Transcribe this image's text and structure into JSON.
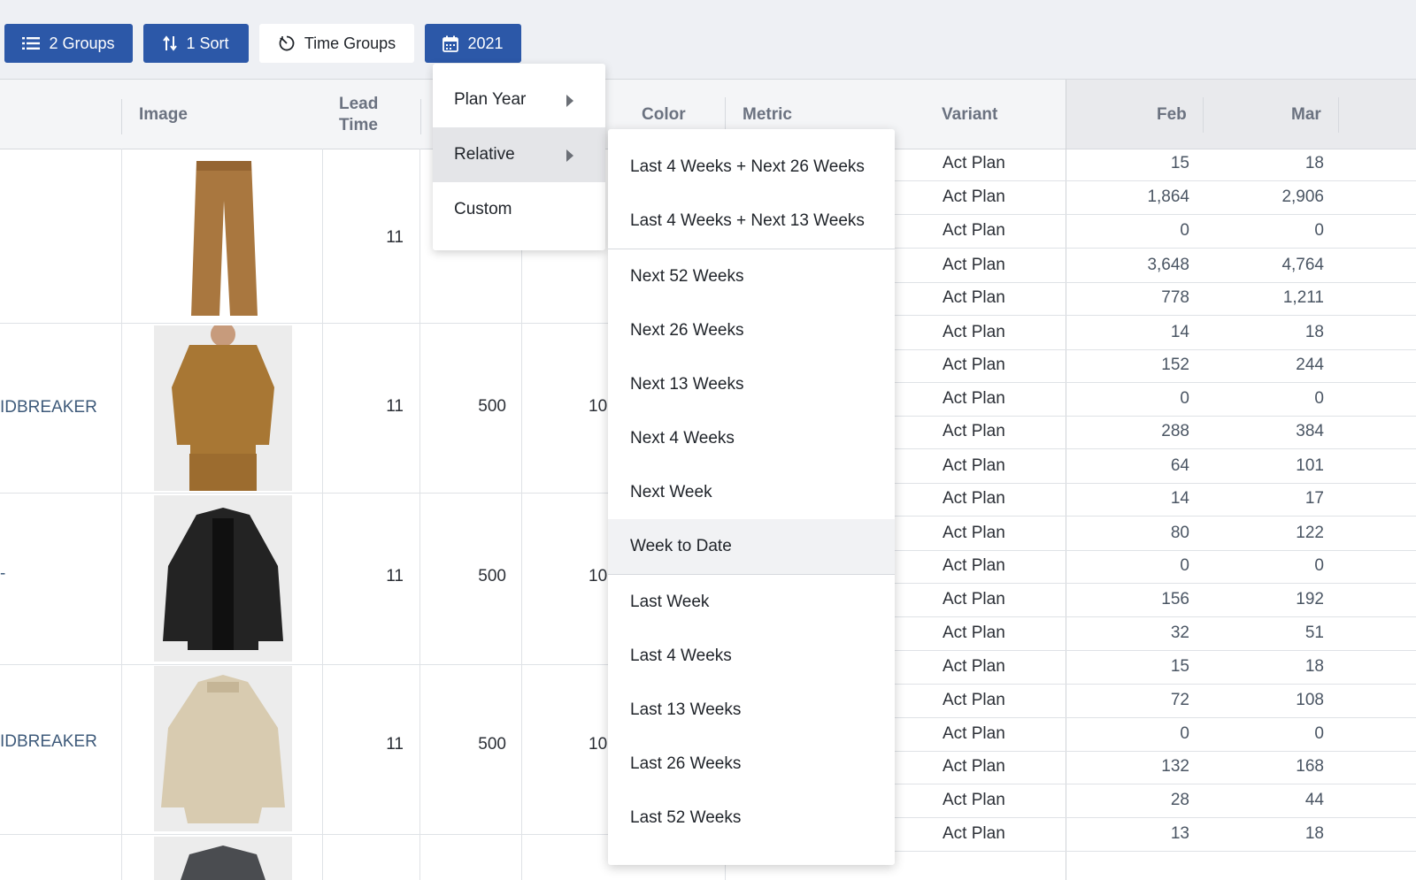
{
  "toolbar": {
    "groups_label": "2 Groups",
    "sort_label": "1 Sort",
    "time_groups_label": "Time Groups",
    "year_label": "2021"
  },
  "headers": {
    "image": "Image",
    "lead_time_line1": "Lead",
    "lead_time_line2": "Time",
    "color": "Color",
    "metric": "Metric",
    "variant": "Variant",
    "feb": "Feb",
    "mar": "Mar"
  },
  "products": [
    {
      "name": "",
      "lead_time": "11",
      "qty": "",
      "extra": "",
      "image_icon": "pants-image"
    },
    {
      "name": "IDBREAKER",
      "lead_time": "11",
      "qty": "500",
      "extra": "10",
      "image_icon": "denim-jacket-image"
    },
    {
      "name": "-",
      "lead_time": "11",
      "qty": "500",
      "extra": "10",
      "image_icon": "leather-jacket-image"
    },
    {
      "name": "IDBREAKER",
      "lead_time": "11",
      "qty": "500",
      "extra": "10",
      "image_icon": "windbreaker-image"
    },
    {
      "name": "",
      "lead_time": "",
      "qty": "",
      "extra": "",
      "image_icon": "blazer-image"
    }
  ],
  "metric_rows": [
    {
      "variant": "Act Plan",
      "feb": "15",
      "mar": "18"
    },
    {
      "variant": "Act Plan",
      "feb": "1,864",
      "mar": "2,906"
    },
    {
      "variant": "Act Plan",
      "feb": "0",
      "mar": "0"
    },
    {
      "variant": "Act Plan",
      "feb": "3,648",
      "mar": "4,764"
    },
    {
      "variant": "Act Plan",
      "feb": "778",
      "mar": "1,211"
    },
    {
      "variant": "Act Plan",
      "feb": "14",
      "mar": "18"
    },
    {
      "variant": "Act Plan",
      "feb": "152",
      "mar": "244"
    },
    {
      "variant": "Act Plan",
      "feb": "0",
      "mar": "0"
    },
    {
      "variant": "Act Plan",
      "feb": "288",
      "mar": "384"
    },
    {
      "variant": "Act Plan",
      "feb": "64",
      "mar": "101"
    },
    {
      "variant": "Act Plan",
      "feb": "14",
      "mar": "17"
    },
    {
      "variant": "Act Plan",
      "feb": "80",
      "mar": "122"
    },
    {
      "variant": "Act Plan",
      "feb": "0",
      "mar": "0"
    },
    {
      "variant": "Act Plan",
      "feb": "156",
      "mar": "192"
    },
    {
      "variant": "Act Plan",
      "feb": "32",
      "mar": "51"
    },
    {
      "variant": "Act Plan",
      "feb": "15",
      "mar": "18"
    },
    {
      "variant": "Act Plan",
      "feb": "72",
      "mar": "108"
    },
    {
      "variant": "Act Plan",
      "feb": "0",
      "mar": "0"
    },
    {
      "variant": "Act Plan",
      "feb": "132",
      "mar": "168"
    },
    {
      "variant": "Act Plan",
      "feb": "28",
      "mar": "44"
    },
    {
      "variant": "Act Plan",
      "feb": "13",
      "mar": "18"
    }
  ],
  "menu_level1": [
    {
      "label": "Plan Year",
      "has_submenu": true
    },
    {
      "label": "Relative",
      "has_submenu": true,
      "active": true
    },
    {
      "label": "Custom",
      "has_submenu": false
    }
  ],
  "menu_relative": [
    "Last 4 Weeks + Next 26 Weeks",
    "Last 4 Weeks + Next 13 Weeks",
    "Next 52 Weeks",
    "Next 26 Weeks",
    "Next 13 Weeks",
    "Next 4 Weeks",
    "Next Week",
    "Week to Date",
    "Last Week",
    "Last 4 Weeks",
    "Last 13 Weeks",
    "Last 26 Weeks",
    "Last 52 Weeks"
  ],
  "menu_relative_highlighted": "Week to Date",
  "colors": {
    "primary_button": "#2c58a8",
    "header_bg": "#f4f5f7",
    "product_link": "#3e5a7a"
  }
}
